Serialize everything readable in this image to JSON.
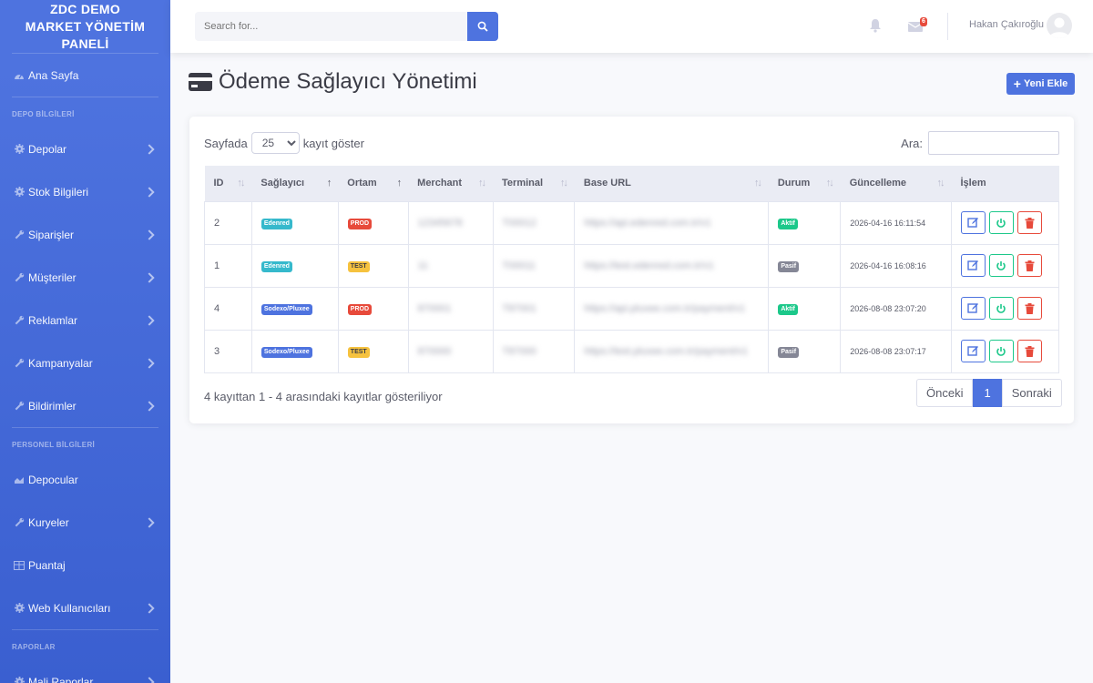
{
  "sidebar": {
    "brand": "ZDC DEMO\nMARKET YÖNETİM\nPANELİ",
    "home": "Ana Sayfa",
    "heading_depo": "DEPO BİLGİLERİ",
    "depo_items": [
      {
        "label": "Depolar",
        "icon": "gear-icon"
      },
      {
        "label": "Stok Bilgileri",
        "icon": "gear-icon"
      },
      {
        "label": "Siparişler",
        "icon": "wrench-icon"
      },
      {
        "label": "Müşteriler",
        "icon": "wrench-icon"
      },
      {
        "label": "Reklamlar",
        "icon": "wrench-icon"
      },
      {
        "label": "Kampanyalar",
        "icon": "wrench-icon"
      },
      {
        "label": "Bildirimler",
        "icon": "wrench-icon"
      }
    ],
    "heading_personel": "PERSONEL BİLGİLERİ",
    "personel_items": [
      {
        "label": "Depocular",
        "icon": "chart-area-icon"
      },
      {
        "label": "Kuryeler",
        "icon": "wrench-icon"
      },
      {
        "label": "Puantaj",
        "icon": "table-icon"
      },
      {
        "label": "Web Kullanıcıları",
        "icon": "gear-icon"
      }
    ],
    "heading_raporlar": "RAPORLAR",
    "rapor_items": [
      {
        "label": "Mali Raporlar",
        "icon": "gear-icon"
      }
    ]
  },
  "topbar": {
    "search_placeholder": "Search for...",
    "mail_count": "6",
    "user_name": "Hakan Çakıroğlu"
  },
  "page": {
    "title": "Ödeme Sağlayıcı Yönetimi",
    "new_button": "Yeni Ekle"
  },
  "table": {
    "length_prefix": "Sayfada",
    "length_value": "25",
    "length_suffix": "kayıt göster",
    "search_label": "Ara:",
    "columns": [
      "ID",
      "Sağlayıcı",
      "Ortam",
      "Merchant",
      "Terminal",
      "Base URL",
      "Durum",
      "Güncelleme",
      "İşlem"
    ],
    "rows": [
      {
        "id": "2",
        "provider": "Edenred",
        "provider_color": "#36b9cc",
        "env": "PROD",
        "merchant": "12345678",
        "terminal": "T00012",
        "base_url": "https://api.edenred.com.tr/v1",
        "status": "Aktif",
        "updated": "2026-04-16 16:11:54"
      },
      {
        "id": "1",
        "provider": "Edenred",
        "provider_color": "#36b9cc",
        "env": "TEST",
        "merchant": "11",
        "terminal": "T00011",
        "base_url": "https://test.edenred.com.tr/v1",
        "status": "Pasif",
        "updated": "2026-04-16 16:08:16"
      },
      {
        "id": "4",
        "provider": "Sodexo/Pluxee",
        "provider_color": "#4e73df",
        "env": "PROD",
        "merchant": "870001",
        "terminal": "T87001",
        "base_url": "https://api.pluxee.com.tr/payment/v1",
        "status": "Aktif",
        "updated": "2026-08-08 23:07:20"
      },
      {
        "id": "3",
        "provider": "Sodexo/Pluxee",
        "provider_color": "#4e73df",
        "env": "TEST",
        "merchant": "870000",
        "terminal": "T87000",
        "base_url": "https://test.pluxee.com.tr/payment/v1",
        "status": "Pasif",
        "updated": "2026-08-08 23:07:17"
      }
    ],
    "info": "4 kayıttan 1 - 4 arasındaki kayıtlar gösteriliyor",
    "pager": {
      "prev": "Önceki",
      "current": "1",
      "next": "Sonraki"
    }
  },
  "colors": {
    "primary": "#4e73df",
    "success": "#1cc88a",
    "danger": "#e74a3b",
    "warning": "#f6c23e",
    "info": "#36b9cc",
    "secondary": "#858796"
  }
}
